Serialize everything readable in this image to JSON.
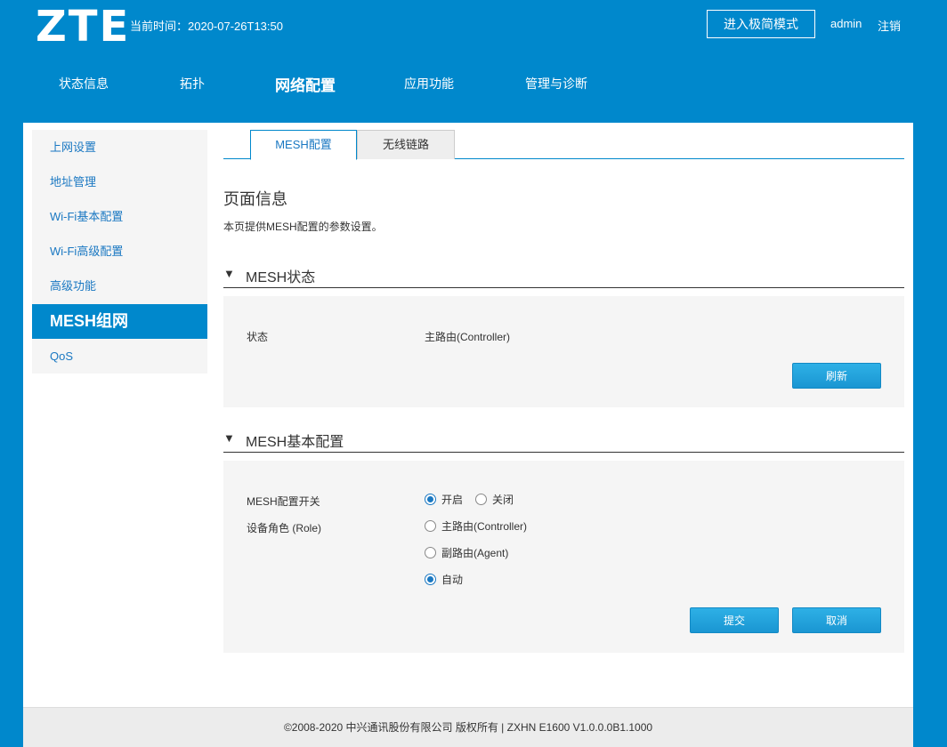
{
  "header": {
    "logo": "ZTE",
    "current_time": "当前时间：2020-07-26T13:50",
    "simple_mode_button": "进入极简模式",
    "user": "admin",
    "logout": "注销"
  },
  "topnav": {
    "items": [
      {
        "label": "状态信息"
      },
      {
        "label": "拓扑"
      },
      {
        "label": "网络配置"
      },
      {
        "label": "应用功能"
      },
      {
        "label": "管理与诊断"
      }
    ]
  },
  "sidebar": {
    "items": [
      {
        "label": "上网设置"
      },
      {
        "label": "地址管理"
      },
      {
        "label": "Wi-Fi基本配置"
      },
      {
        "label": "Wi-Fi高级配置"
      },
      {
        "label": "高级功能"
      },
      {
        "label": "MESH组网"
      },
      {
        "label": "QoS"
      }
    ]
  },
  "tabs": [
    {
      "label": "MESH配置"
    },
    {
      "label": "无线链路"
    }
  ],
  "page": {
    "title": "页面信息",
    "description": "本页提供MESH配置的参数设置。"
  },
  "mesh_status": {
    "heading": "MESH状态",
    "arrow": "▼",
    "state_label": "状态",
    "state_value": "主路由(Controller)",
    "refresh_button": "刷新"
  },
  "mesh_basic": {
    "heading": "MESH基本配置",
    "arrow": "▼",
    "switch_label": "MESH配置开关",
    "switch_on": "开启",
    "switch_off": "关闭",
    "role_label": "设备角色 (Role)",
    "role_controller": "主路由(Controller)",
    "role_agent": "副路由(Agent)",
    "role_auto": "自动",
    "submit_button": "提交",
    "cancel_button": "取消"
  },
  "footer": {
    "text": "©2008-2020 中兴通讯股份有限公司 版权所有  |   ZXHN E1600 V1.0.0.0B1.1000"
  },
  "colors": {
    "brand": "#0088cc",
    "link": "#1a78c2",
    "panel_bg": "#f5f5f5"
  }
}
